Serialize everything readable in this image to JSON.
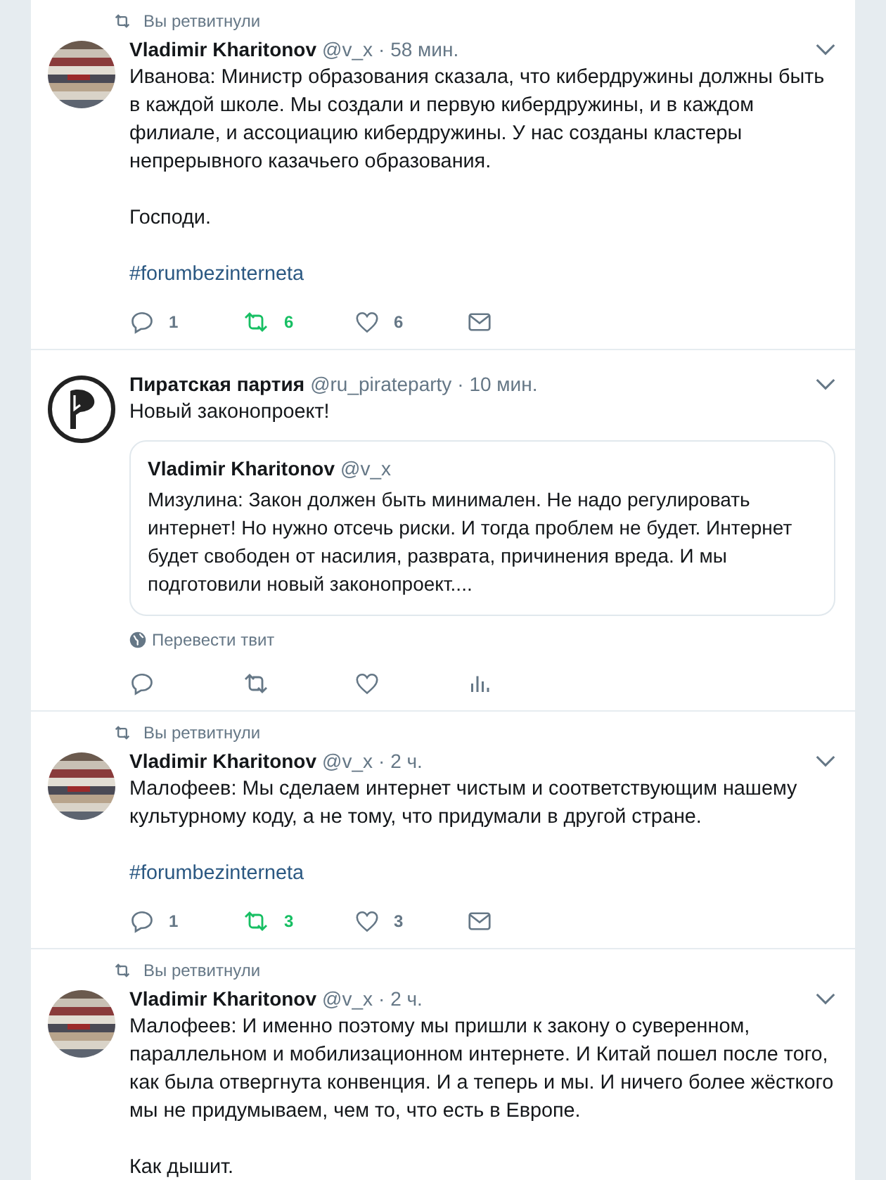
{
  "tweets": [
    {
      "retweet_note": "Вы ретвитнули",
      "avatar": {
        "kind": "picture"
      },
      "author": "Vladimir Kharitonov",
      "handle": "@v_x",
      "time": "· 58 мин.",
      "paragraphs": [
        "Иванова: Министр образования сказала, что кибердружины должны быть в каждой школе. Мы создали и первую кибердружины, и в каждом филиале, и ассоциацию кибердружины. У нас созданы кластеры непрерывного казачьего образования.",
        "Господи."
      ],
      "hashtag": "#forumbezinterneta",
      "actions": [
        {
          "kind": "reply",
          "count": "1"
        },
        {
          "kind": "retweet",
          "count": "6",
          "on": true
        },
        {
          "kind": "like",
          "count": "6",
          "on": false
        },
        {
          "kind": "message"
        }
      ]
    },
    {
      "avatar": {
        "kind": "flag-logo"
      },
      "author": "Пиратская партия",
      "handle": "@ru_pirateparty",
      "time": "· 10 мин.",
      "paragraphs": [
        "Новый законопроект!"
      ],
      "quote": {
        "author": "Vladimir Kharitonov",
        "handle": "@v_x",
        "text": "Мизулина: Закон должен быть минимален. Не надо регулировать интернет! Но нужно отсечь риски. И тогда проблем не будет. Интернет будет свободен от насилия, разврата, причинения вреда. И мы подготовили новый законопроект...."
      },
      "translate": "Перевести твит",
      "actions": [
        {
          "kind": "reply"
        },
        {
          "kind": "retweet",
          "on": false
        },
        {
          "kind": "like",
          "on": false
        },
        {
          "kind": "analytics"
        }
      ]
    },
    {
      "retweet_note": "Вы ретвитнули",
      "avatar": {
        "kind": "picture"
      },
      "author": "Vladimir Kharitonov",
      "handle": "@v_x",
      "time": "· 2 ч.",
      "paragraphs": [
        "Малофеев: Мы сделаем интернет чистым и соответствующим нашему культурному коду, а не тому, что придумали в другой стране."
      ],
      "hashtag": "#forumbezinterneta",
      "actions": [
        {
          "kind": "reply",
          "count": "1"
        },
        {
          "kind": "retweet",
          "count": "3",
          "on": true
        },
        {
          "kind": "like",
          "count": "3",
          "on": false
        },
        {
          "kind": "message"
        }
      ]
    },
    {
      "retweet_note": "Вы ретвитнули",
      "avatar": {
        "kind": "picture"
      },
      "author": "Vladimir Kharitonov",
      "handle": "@v_x",
      "time": "· 2 ч.",
      "paragraphs": [
        "Малофеев: И именно поэтому мы пришли к закону о суверенном, параллельном и мобилизационном интернете. И Китай пошел после того, как была отвергнута конвенция. И а теперь и мы. И ничего более жёсткого мы не придумываем, чем то, что есть в Европе.",
        "Как дышит."
      ]
    }
  ]
}
